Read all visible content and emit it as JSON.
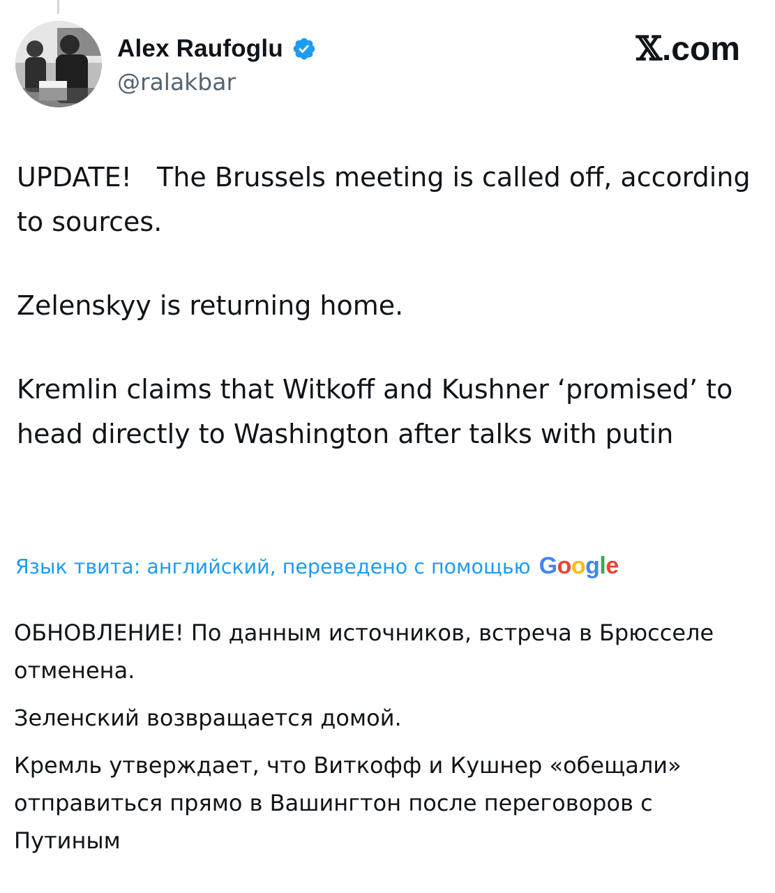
{
  "author": {
    "display_name": "Alex Raufoglu",
    "handle": "@ralakbar",
    "avatar_icon": "avatar-photo",
    "verified_icon": "verified-badge-icon",
    "verified_color": "#1d9bf0"
  },
  "brand": {
    "logo_glyph": "𝕏",
    "logo_suffix": ".com"
  },
  "tweet": {
    "paragraphs": [
      "UPDATE!   The Brussels meeting is called off, according to sources.",
      "Zelenskyy is returning home.",
      "Kremlin claims that Witkoff and Kushner ‘promised’ to head directly to Washington after talks with putin"
    ]
  },
  "translation": {
    "note": "Язык твита: английский, переведено с помощью",
    "provider": {
      "letters": [
        "G",
        "o",
        "o",
        "g",
        "l",
        "e"
      ]
    },
    "paragraphs": [
      "ОБНОВЛЕНИЕ! По данным источников, встреча в Брюсселе отменена.",
      "Зеленский возвращается домой.",
      "Кремль утверждает, что Виткофф и Кушнер «обещали» отправиться прямо в Вашингтон после переговоров с Путиным"
    ]
  },
  "colors": {
    "text": "#0f1419",
    "secondary_text": "#536471",
    "link": "#1d9bf0",
    "google_blue": "#4285f4",
    "google_red": "#ea4335",
    "google_yellow": "#fbbc05",
    "google_green": "#34a853"
  }
}
